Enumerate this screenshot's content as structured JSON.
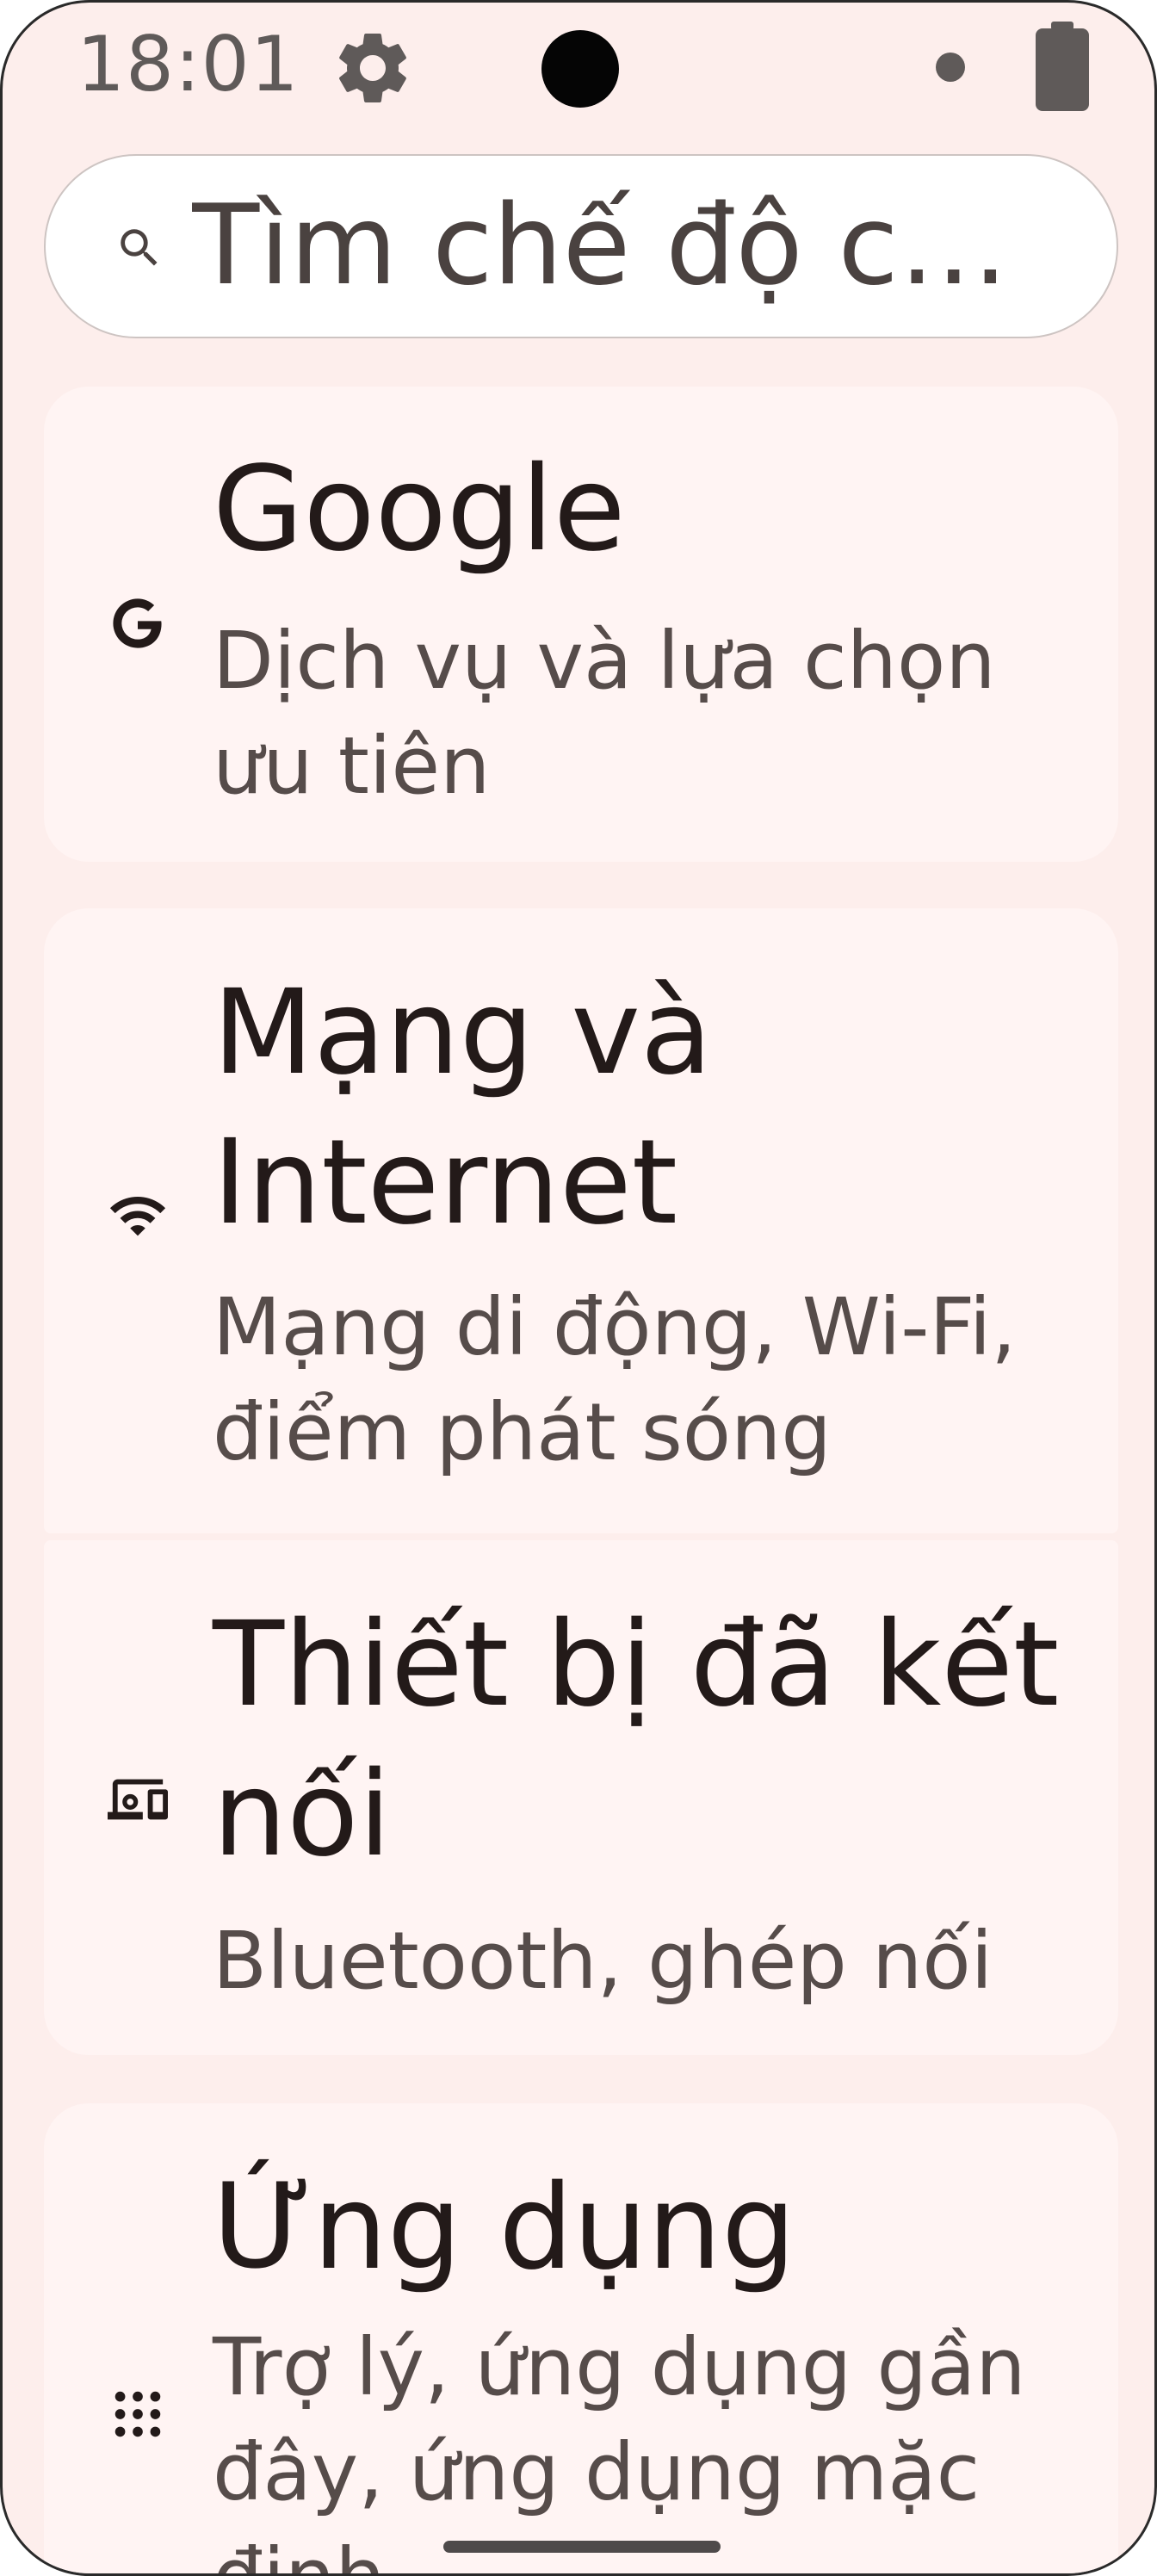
{
  "status_bar": {
    "time": "18:01",
    "icons": [
      "gear-icon",
      "camera-cutout",
      "notification-dot-icon",
      "battery-icon"
    ]
  },
  "search": {
    "value": "Tìm chế độ c…"
  },
  "settings": [
    {
      "id": "google",
      "icon": "google-g-icon",
      "title": "Google",
      "subtitle": "Dịch vụ và lựa chọn ưu tiên"
    },
    {
      "id": "network",
      "icon": "wifi-icon",
      "title": "Mạng và Internet",
      "subtitle": "Mạng di động, Wi‑Fi, điểm phát sóng"
    },
    {
      "id": "connected-devices",
      "icon": "connected-devices-icon",
      "title": "Thiết bị đã kết nối",
      "subtitle": "Bluetooth, ghép nối"
    },
    {
      "id": "apps",
      "icon": "apps-grid-icon",
      "title": "Ứng dụng",
      "subtitle": "Trợ lý, ứng dụng gần đây, ứng dụng mặc định"
    }
  ],
  "colors": {
    "background": "#fdeeec",
    "card": "#fff4f3",
    "title_text": "#231a19",
    "subtitle_text": "#564c4a"
  }
}
